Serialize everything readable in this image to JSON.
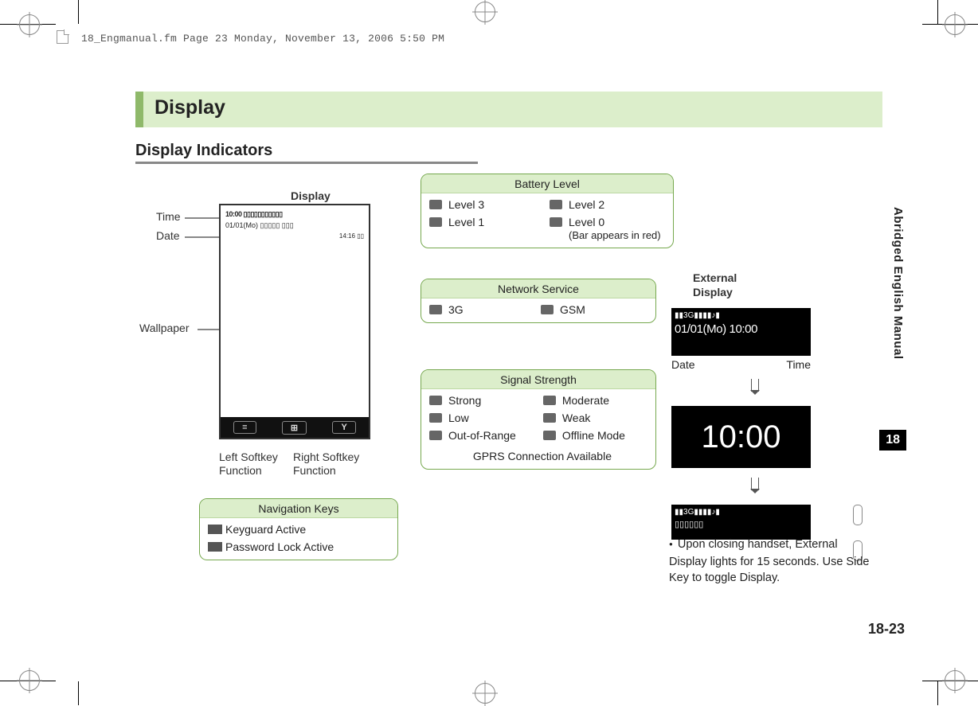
{
  "header": {
    "framemaker_line": "18_Engmanual.fm  Page 23  Monday, November 13, 2006  5:50 PM"
  },
  "title": "Display",
  "subhead": "Display Indicators",
  "side": {
    "manual_title": "Abridged English Manual",
    "chapter": "18",
    "folio": "18-23"
  },
  "main_display": {
    "label": "Display",
    "time_label": "Time",
    "date_label": "Date",
    "wallpaper_label": "Wallpaper",
    "left_softkey_label_l1": "Left Softkey",
    "left_softkey_label_l2": "Function",
    "right_softkey_label_l1": "Right Softkey",
    "right_softkey_label_l2": "Function",
    "status_time": "10:00",
    "status_date": "01/01(Mo)",
    "status_mini_time": "14:16"
  },
  "external_display": {
    "label_l1": "External",
    "label_l2": "Display",
    "date_label": "Date",
    "time_label": "Time",
    "line1_icons": "▮▮3G▮▮▮▮♪▮",
    "line2": "01/01(Mo) 10:00",
    "big_time": "10:00"
  },
  "battery_box": {
    "title": "Battery Level",
    "level3": "Level 3",
    "level2": "Level 2",
    "level1": "Level 1",
    "level0": "Level 0",
    "level0_note": "(Bar appears in red)"
  },
  "network_box": {
    "title": "Network Service",
    "threeg": "3G",
    "gsm": "GSM"
  },
  "signal_box": {
    "title": "Signal Strength",
    "strong": "Strong",
    "moderate": "Moderate",
    "low": "Low",
    "weak": "Weak",
    "oor": "Out-of-Range",
    "offline": "Offline Mode",
    "gprs": "GPRS Connection Available"
  },
  "nav_box": {
    "title": "Navigation Keys",
    "keyguard": "Keyguard Active",
    "pwlock": "Password Lock Active"
  },
  "note": "Upon closing handset, External Display lights for 15 seconds. Use Side Key to toggle Display."
}
